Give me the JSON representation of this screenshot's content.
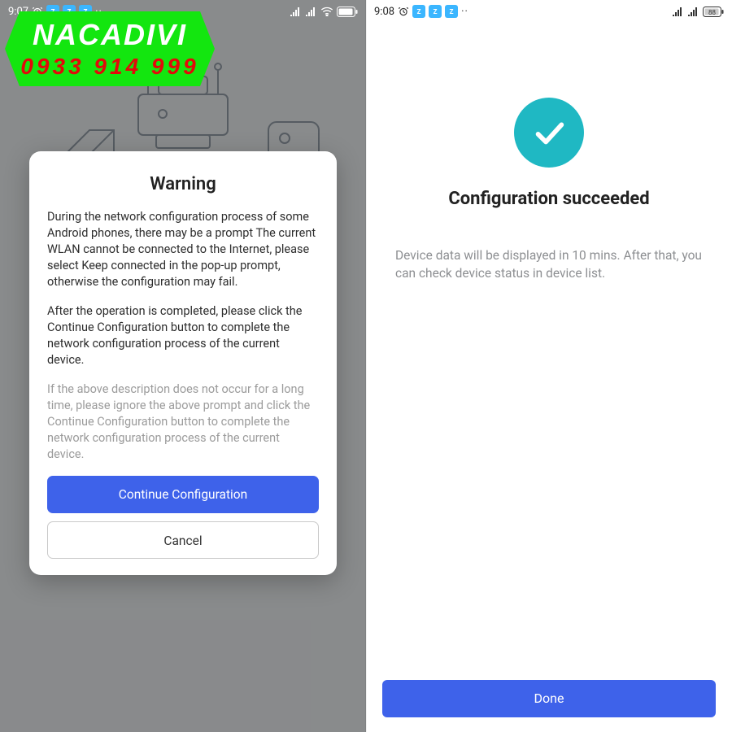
{
  "watermark": {
    "title": "NACADIVI",
    "phone": "0933 914 999"
  },
  "left": {
    "status": {
      "time": "9:07",
      "batt": "88"
    },
    "title": "Warning",
    "p1": "During the network configuration process of some Android phones, there may be a prompt The current WLAN cannot be connected to the Internet, please select Keep connected in the pop-up prompt, otherwise the configuration may fail.",
    "p2": "After the operation is completed, please click the Continue Configuration button to complete the network configuration process of the current device.",
    "p3": "If the above description does not occur for a long time, please ignore the above prompt and click the Continue Configuration button to complete the network configuration process of the current device.",
    "primary": "Continue Configuration",
    "secondary": "Cancel"
  },
  "right": {
    "status": {
      "time": "9:08",
      "batt": "88"
    },
    "title": "Configuration succeeded",
    "body": "Device data will be displayed in 10 mins. After that, you can check device status in device list.",
    "done": "Done"
  }
}
